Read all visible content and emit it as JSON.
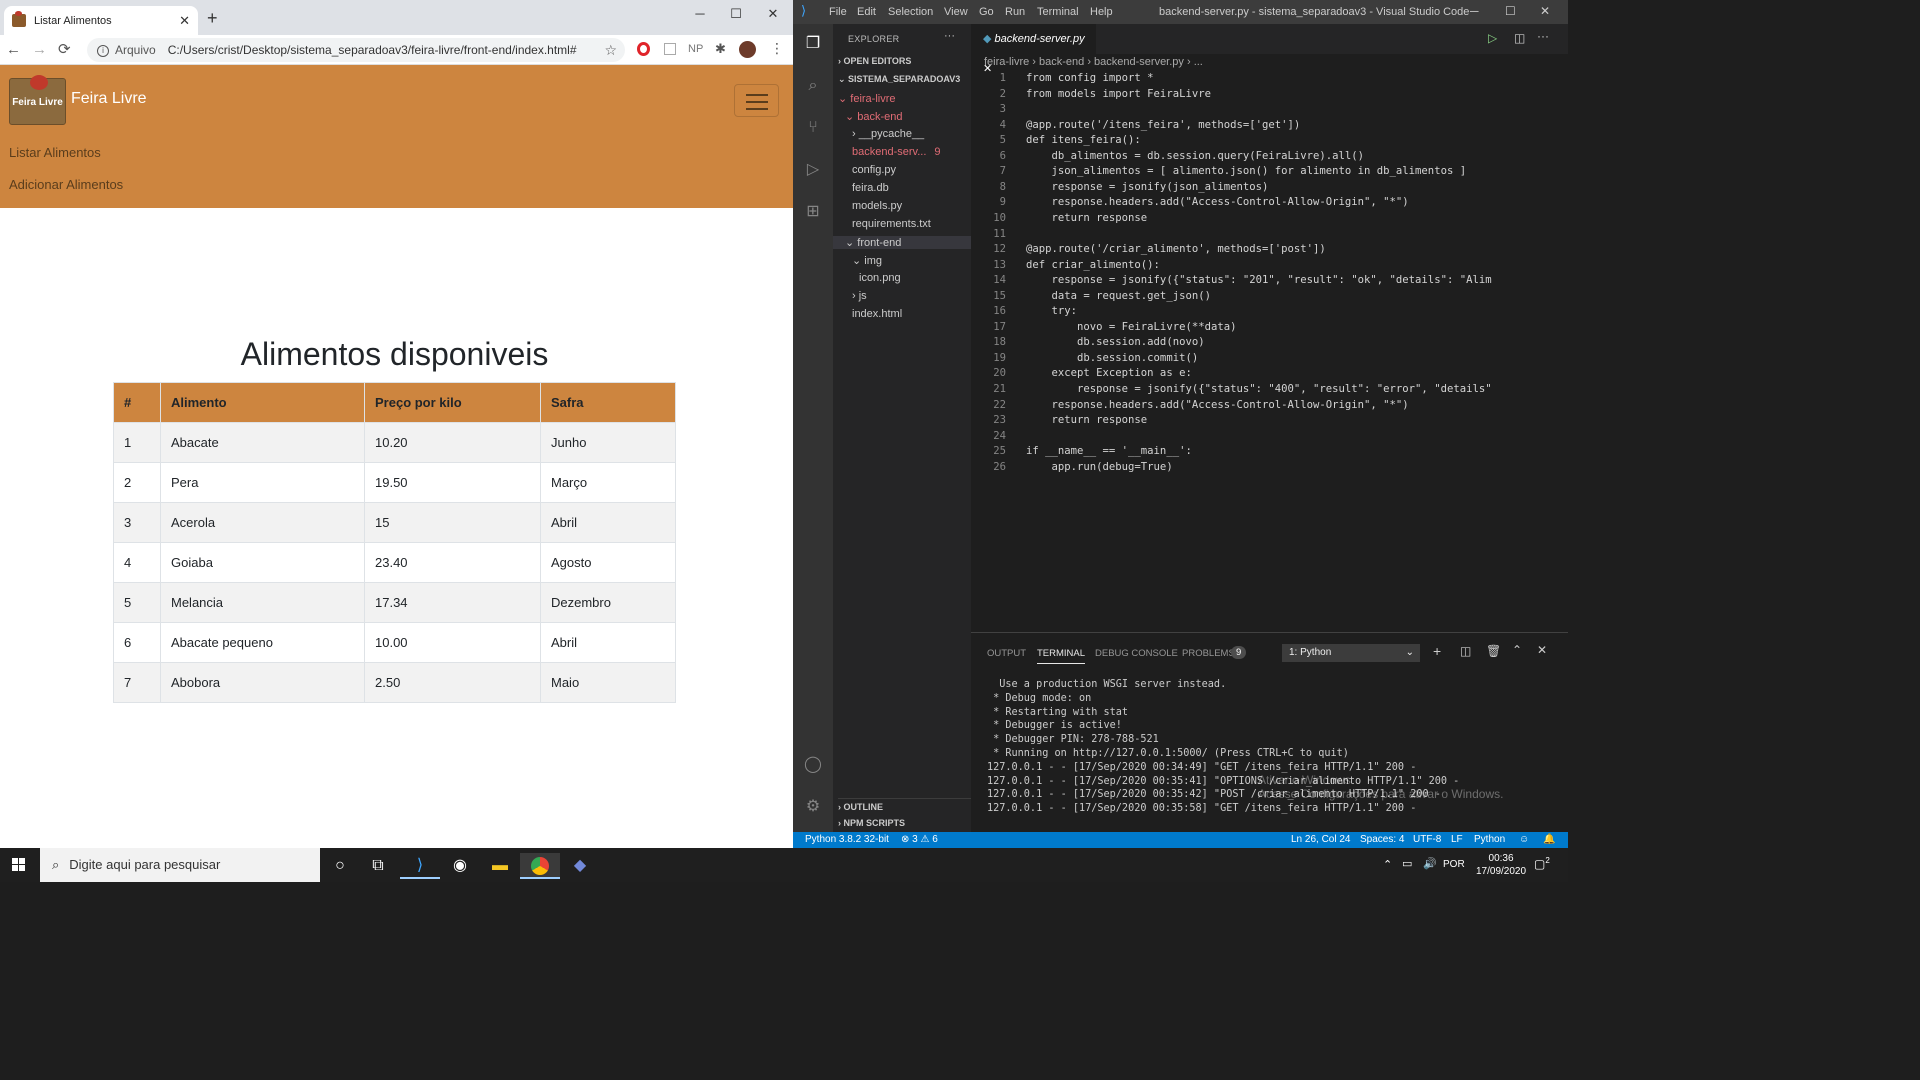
{
  "browser": {
    "tab_title": "Listar Alimentos",
    "tab_close": "✕",
    "new_tab": "+",
    "win_min": "─",
    "win_max": "☐",
    "win_close": "✕",
    "back": "←",
    "forward": "→",
    "reload": "⟳",
    "url_prefix": "Arquivo",
    "url": "C:/Users/crist/Desktop/sistema_separadoav3/feira-livre/front-end/index.html#",
    "star": "☆",
    "ext_np": "NP"
  },
  "page": {
    "brand": "Feira Livre",
    "logo_text": "Feira Livre",
    "nav": [
      "Listar Alimentos",
      "Adicionar Alimentos"
    ],
    "heading": "Alimentos disponiveis",
    "table": {
      "headers": [
        "#",
        "Alimento",
        "Preço por kilo",
        "Safra"
      ],
      "rows": [
        [
          "1",
          "Abacate",
          "10.20",
          "Junho"
        ],
        [
          "2",
          "Pera",
          "19.50",
          "Março"
        ],
        [
          "3",
          "Acerola",
          "15",
          "Abril"
        ],
        [
          "4",
          "Goiaba",
          "23.40",
          "Agosto"
        ],
        [
          "5",
          "Melancia",
          "17.34",
          "Dezembro"
        ],
        [
          "6",
          "Abacate pequeno",
          "10.00",
          "Abril"
        ],
        [
          "7",
          "Abobora",
          "2.50",
          "Maio"
        ]
      ]
    }
  },
  "vscode": {
    "menu": [
      "File",
      "Edit",
      "Selection",
      "View",
      "Go",
      "Run",
      "Terminal",
      "Help"
    ],
    "window_title": "backend-server.py - sistema_separadoav3 - Visual Studio Code",
    "explorer_title": "EXPLORER",
    "explorer_more": "···",
    "open_editors": "OPEN EDITORS",
    "project": "SISTEMA_SEPARADOAV3",
    "tree": [
      {
        "label": "feira-livre",
        "indent": 1,
        "color": "#e06c75",
        "arrow": "⌄"
      },
      {
        "label": "back-end",
        "indent": 2,
        "color": "#e06c75",
        "arrow": "⌄"
      },
      {
        "label": "__pycache__",
        "indent": 3,
        "color": "#cccccc",
        "arrow": "›"
      },
      {
        "label": "backend-serv...",
        "indent": 3,
        "color": "#e06c75",
        "arrow": "",
        "badge": "9"
      },
      {
        "label": "config.py",
        "indent": 3,
        "color": "#cccccc",
        "arrow": ""
      },
      {
        "label": "feira.db",
        "indent": 3,
        "color": "#cccccc",
        "arrow": ""
      },
      {
        "label": "models.py",
        "indent": 3,
        "color": "#cccccc",
        "arrow": ""
      },
      {
        "label": "requirements.txt",
        "indent": 3,
        "color": "#cccccc",
        "arrow": ""
      },
      {
        "label": "front-end",
        "indent": 2,
        "color": "#cccccc",
        "arrow": "⌄"
      },
      {
        "label": "img",
        "indent": 3,
        "color": "#cccccc",
        "arrow": "⌄"
      },
      {
        "label": "icon.png",
        "indent": 4,
        "color": "#cccccc",
        "arrow": ""
      },
      {
        "label": "js",
        "indent": 3,
        "color": "#cccccc",
        "arrow": "›"
      },
      {
        "label": "index.html",
        "indent": 3,
        "color": "#cccccc",
        "arrow": ""
      }
    ],
    "outline": "OUTLINE",
    "npm": "NPM SCRIPTS",
    "editor_tab": "backend-server.py",
    "breadcrumb": "feira-livre  ›  back-end  ›  backend-server.py  ›  ...",
    "code": [
      "from config import *",
      "from models import FeiraLivre",
      "",
      "@app.route('/itens_feira', methods=['get'])",
      "def itens_feira():",
      "    db_alimentos = db.session.query(FeiraLivre).all()",
      "    json_alimentos = [ alimento.json() for alimento in db_alimentos ]",
      "    response = jsonify(json_alimentos)",
      "    response.headers.add(\"Access-Control-Allow-Origin\", \"*\")",
      "    return response",
      "",
      "@app.route('/criar_alimento', methods=['post'])",
      "def criar_alimento():",
      "    response = jsonify({\"status\": \"201\", \"result\": \"ok\", \"details\": \"Alim",
      "    data = request.get_json()",
      "    try:",
      "        novo = FeiraLivre(**data)",
      "        db.session.add(novo)",
      "        db.session.commit()",
      "    except Exception as e:",
      "        response = jsonify({\"status\": \"400\", \"result\": \"error\", \"details\"",
      "    response.headers.add(\"Access-Control-Allow-Origin\", \"*\")",
      "    return response",
      "",
      "if __name__ == '__main__':",
      "    app.run(debug=True)"
    ],
    "panel_tabs": [
      "OUTPUT",
      "TERMINAL",
      "DEBUG CONSOLE",
      "PROBLEMS"
    ],
    "problems_count": "9",
    "terminal_select": "1: Python",
    "terminal": [
      "  Use a production WSGI server instead.",
      " * Debug mode: on",
      " * Restarting with stat",
      " * Debugger is active!",
      " * Debugger PIN: 278-788-521",
      " * Running on http://127.0.0.1:5000/ (Press CTRL+C to quit)",
      "127.0.0.1 - - [17/Sep/2020 00:34:49] \"GET /itens_feira HTTP/1.1\" 200 -",
      "127.0.0.1 - - [17/Sep/2020 00:35:41] \"OPTIONS /criar_alimento HTTP/1.1\" 200 -",
      "127.0.0.1 - - [17/Sep/2020 00:35:42] \"POST /criar_alimento HTTP/1.1\" 200 -",
      "127.0.0.1 - - [17/Sep/2020 00:35:58] \"GET /itens_feira HTTP/1.1\" 200 -"
    ],
    "status": {
      "python": "Python 3.8.2 32-bit",
      "problems": "⊗ 3 ⚠ 6",
      "position": "Ln 26, Col 24",
      "spaces": "Spaces: 4",
      "encoding": "UTF-8",
      "eol": "LF",
      "language": "Python"
    },
    "watermark_line1": "Ativar o Windows",
    "watermark_line2": "Acesse Configurações para ativar o Windows."
  },
  "taskbar": {
    "search_placeholder": "Digite aqui para pesquisar",
    "lang": "POR",
    "time": "00:36",
    "date": "17/09/2020",
    "notif": "2"
  },
  "colors": {
    "navbar": "#cd853f",
    "vscode_blue": "#007acc"
  }
}
